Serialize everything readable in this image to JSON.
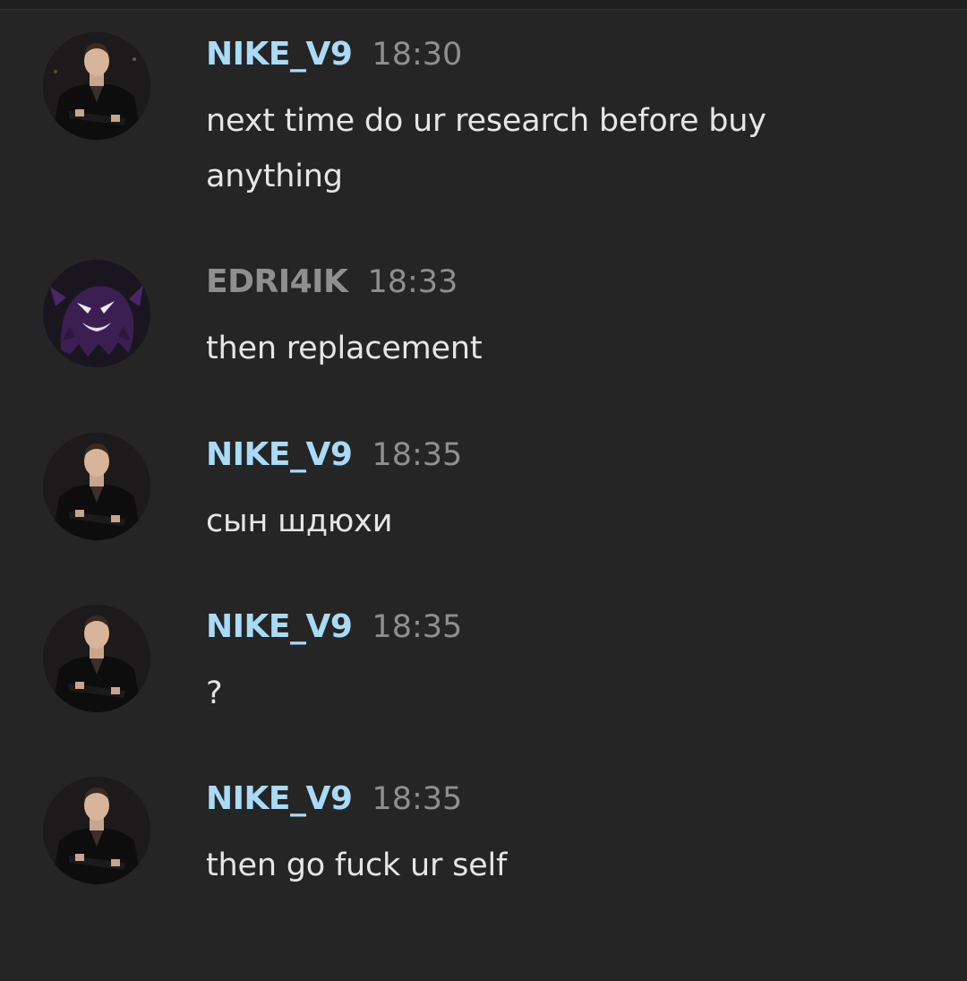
{
  "colors": {
    "background": "#252525",
    "author_nike": "#a9dbf7",
    "author_edri": "#8f8f8f",
    "timestamp": "#8f8f8f",
    "message_text": "#e6e6e6"
  },
  "messages": [
    {
      "author": "NIKE_V9",
      "author_color": "#a9dbf7",
      "avatar": "man-portrait-avatar",
      "time": "18:30",
      "text": "next time do ur research before buy anything"
    },
    {
      "author": "EDRI4IK",
      "author_color": "#8f8f8f",
      "avatar": "purple-ghost-avatar",
      "time": "18:33",
      "text": "then replacement"
    },
    {
      "author": "NIKE_V9",
      "author_color": "#a9dbf7",
      "avatar": "man-portrait-avatar",
      "time": "18:35",
      "text": "сын шдюхи"
    },
    {
      "author": "NIKE_V9",
      "author_color": "#a9dbf7",
      "avatar": "man-portrait-avatar",
      "time": "18:35",
      "text": "?"
    },
    {
      "author": "NIKE_V9",
      "author_color": "#a9dbf7",
      "avatar": "man-portrait-avatar",
      "time": "18:35",
      "text": "then go fuck ur self"
    }
  ]
}
